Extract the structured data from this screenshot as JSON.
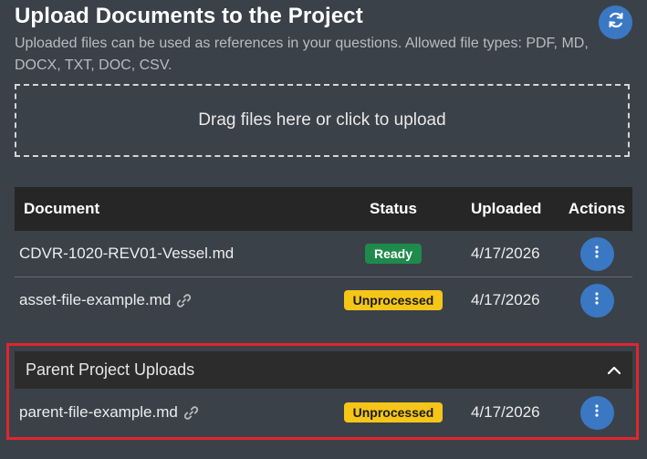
{
  "header": {
    "title": "Upload Documents to the Project",
    "subtitle": "Uploaded files can be used as references in your questions. Allowed file types: PDF, MD, DOCX, TXT, DOC, CSV."
  },
  "dropzone": {
    "label": "Drag files here or click to upload"
  },
  "table": {
    "columns": {
      "document": "Document",
      "status": "Status",
      "uploaded": "Uploaded",
      "actions": "Actions"
    },
    "rows": [
      {
        "name": "CDVR-1020-REV01-Vessel.md",
        "status": "Ready",
        "uploaded": "4/17/2026",
        "linked": false
      },
      {
        "name": "asset-file-example.md",
        "status": "Unprocessed",
        "uploaded": "4/17/2026",
        "linked": true
      }
    ]
  },
  "parent_uploads": {
    "label": "Parent Project Uploads",
    "rows": [
      {
        "name": "parent-file-example.md",
        "status": "Unprocessed",
        "uploaded": "4/17/2026",
        "linked": true
      }
    ]
  },
  "colors": {
    "background": "#3b4149",
    "accent_blue": "#3a78c4",
    "ready_green": "#1e8a4c",
    "unprocessed_yellow": "#f5c518",
    "highlight_red": "#e0262e"
  },
  "icons": {
    "refresh": "refresh-icon",
    "actions": "kebab-menu-icon",
    "link": "link-icon",
    "collapse": "chevron-up-icon"
  }
}
